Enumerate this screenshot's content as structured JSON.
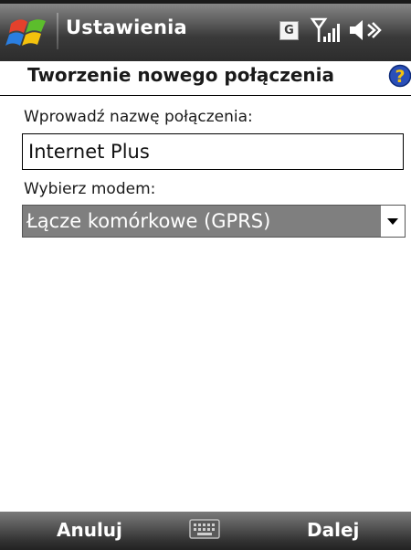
{
  "titlebar": {
    "title": "Ustawienia",
    "status_network_letter": "G",
    "icons": [
      "windows-start-icon",
      "network-g-icon",
      "signal-strength-icon",
      "volume-icon"
    ]
  },
  "page": {
    "heading": "Tworzenie nowego połączenia",
    "help_icon": "help-icon"
  },
  "form": {
    "name_label": "Wprowadź nazwę połączenia:",
    "name_value": "Internet Plus",
    "modem_label": "Wybierz modem:",
    "modem_value": "Łącze komórkowe (GPRS)"
  },
  "softkeys": {
    "left": "Anuluj",
    "right": "Dalej",
    "center_icon": "keyboard-icon"
  },
  "colors": {
    "titlebar": "#3a3a3a",
    "selection": "#7f7f7f",
    "help_icon": "#2a4fb8"
  }
}
